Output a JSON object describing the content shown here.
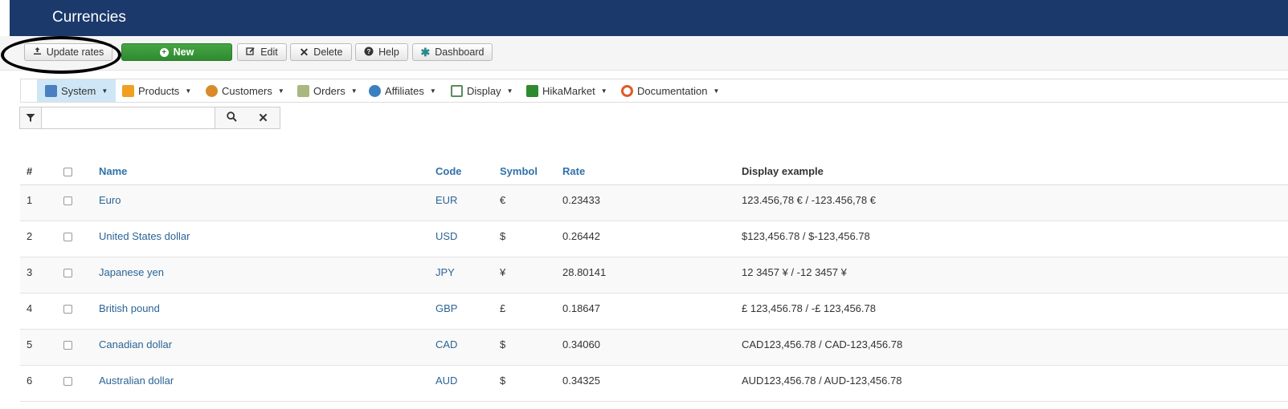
{
  "header": {
    "title": "Currencies"
  },
  "toolbar": {
    "update_rates": "Update rates",
    "new": "New",
    "edit": "Edit",
    "delete": "Delete",
    "help": "Help",
    "dashboard": "Dashboard"
  },
  "menu": {
    "items": [
      {
        "label": "System",
        "icon": "wrench-icon",
        "color": "#4a7fc1"
      },
      {
        "label": "Products",
        "icon": "box-icon",
        "color": "#f0a020"
      },
      {
        "label": "Customers",
        "icon": "users-icon",
        "color": "#d98a2b"
      },
      {
        "label": "Orders",
        "icon": "clipboard-icon",
        "color": "#8aa060"
      },
      {
        "label": "Affiliates",
        "icon": "network-icon",
        "color": "#3a7fc0"
      },
      {
        "label": "Display",
        "icon": "monitor-icon",
        "color": "#5a8a60"
      },
      {
        "label": "HikaMarket",
        "icon": "asterisk-icon",
        "color": "#2e8a2e"
      },
      {
        "label": "Documentation",
        "icon": "lifebuoy-icon",
        "color": "#e05a2a"
      }
    ]
  },
  "filter": {
    "value": ""
  },
  "table": {
    "headers": {
      "num": "#",
      "name": "Name",
      "code": "Code",
      "symbol": "Symbol",
      "rate": "Rate",
      "example": "Display example"
    },
    "rows": [
      {
        "num": "1",
        "name": "Euro",
        "code": "EUR",
        "symbol": "€",
        "rate": "0.23433",
        "example": "123.456,78 € / -123.456,78 €"
      },
      {
        "num": "2",
        "name": "United States dollar",
        "code": "USD",
        "symbol": "$",
        "rate": "0.26442",
        "example": "$123,456.78 / $-123,456.78"
      },
      {
        "num": "3",
        "name": "Japanese yen",
        "code": "JPY",
        "symbol": "¥",
        "rate": "28.80141",
        "example": "12 3457 ¥ / -12 3457 ¥"
      },
      {
        "num": "4",
        "name": "British pound",
        "code": "GBP",
        "symbol": "£",
        "rate": "0.18647",
        "example": "£ 123,456.78 / -£ 123,456.78"
      },
      {
        "num": "5",
        "name": "Canadian dollar",
        "code": "CAD",
        "symbol": "$",
        "rate": "0.34060",
        "example": "CAD123,456.78 / CAD-123,456.78"
      },
      {
        "num": "6",
        "name": "Australian dollar",
        "code": "AUD",
        "symbol": "$",
        "rate": "0.34325",
        "example": "AUD123,456.78 / AUD-123,456.78"
      }
    ]
  }
}
